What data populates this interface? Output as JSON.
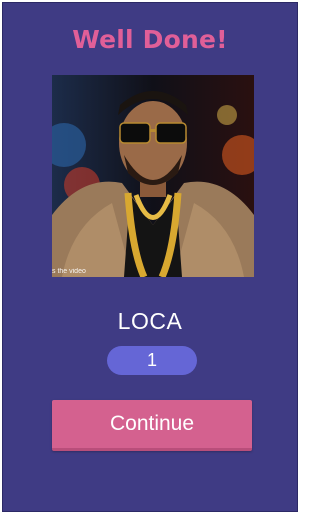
{
  "header": {
    "title": "Well Done!"
  },
  "image": {
    "caption": "s the video",
    "icon": "artist-photo"
  },
  "result": {
    "answer": "LOCA",
    "score": "1"
  },
  "actions": {
    "continue_label": "Continue"
  },
  "colors": {
    "background": "#3f3b84",
    "title": "#e05f98",
    "score_pill": "#6566d6",
    "button": "#d4618f"
  }
}
